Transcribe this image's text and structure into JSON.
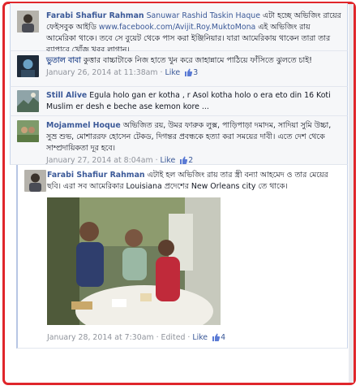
{
  "comments": [
    {
      "author": "Farabi Shafiur Rahman",
      "tags": "Sanuwar Rashid Taskin Haque",
      "text_a": "এটা হচ্ছে অভিজিং রায়ের ফেইসবুক আইডি",
      "url": "www.facebook.com/Avijit.Roy.MuktoMona",
      "text_b": "এই অভিজিং রায় আমেরিকা থাকে। তবে সে বুয়েট থেকে পাস করা ইঞ্জিনিয়ার। যারা আমেরিকায় থাকেন তারা তার ব্যাপারে খোঁজ খবর লাগান।"
    },
    {
      "author": "ভুতাল বাবা",
      "text": "কুত্তার বাচ্চাটাকে নিজ হাতে খুন করে জাহান্নামে পাঠিয়ে ফাঁসিতে ঝুলতে চাই!",
      "time": "January 26, 2014 at 11:38am",
      "like_label": "Like",
      "likes": "3"
    },
    {
      "author": "Still Alive",
      "text": "Egula holo gan er kotha , r Asol kotha holo o era eto din 16 Koti Muslim er desh e beche ase kemon kore ..."
    },
    {
      "author": "Mojammel Hoque",
      "text": "অভিজিত রয়, উমর ফারুক লুক্স, পাড়িপাড়া দমাদম, সাদিয়া সুমি উচ্চা, সুভ্র শুভ, মোশাররফ হোসেন টেকড, দিগন্তর প্রবন্ধকে হত্যা করা সময়ের দাবী। এতে দেশ থেকে সাম্প্রদায়িকতা দূর হবে।",
      "time": "January 27, 2014 at 8:04am",
      "like_label": "Like",
      "likes": "2"
    },
    {
      "author": "Farabi Shafiur Rahman",
      "text": "এটাই হল অভিজিং রায় তার স্ত্রী বন্যা আহমেদ ও তার মেয়ের ছবি। এরা সব আমেরিকার Louisiana প্রদেশের New Orleans city তে থাকে।",
      "time": "January 28, 2014 at 7:30am",
      "edited": "Edited",
      "like_label": "Like",
      "likes": "4"
    }
  ],
  "separator": "·",
  "colors": {
    "link": "#3b5998",
    "border": "#e0262b",
    "meta": "#90949c"
  },
  "icons": {
    "like": "thumbs-up-icon"
  }
}
